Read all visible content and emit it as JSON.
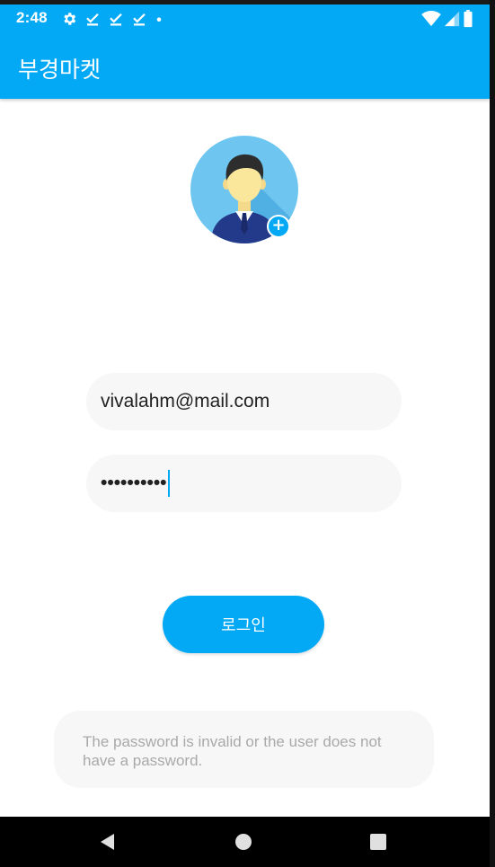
{
  "status_bar": {
    "time": "2:48",
    "left_icons": [
      "settings-gear-icon",
      "download-done-icon",
      "download-done-icon",
      "download-done-icon",
      "notification-dot-icon"
    ],
    "right_icons": [
      "wifi-icon",
      "cellular-signal-icon",
      "battery-icon"
    ]
  },
  "app_bar": {
    "title": "부경마켓"
  },
  "profile": {
    "avatar_icon": "user-avatar-icon",
    "add_badge": "+"
  },
  "login_form": {
    "email_value": "vivalahm@mail.com",
    "password_value": "••••••••••",
    "login_label": "로그인"
  },
  "error": {
    "message": "The password is invalid or the user does not have a password."
  },
  "nav_bar": {
    "back_icon": "back-triangle-icon",
    "home_icon": "home-circle-icon",
    "recents_icon": "recents-square-icon"
  },
  "colors": {
    "primary": "#03a9f4",
    "field_bg": "#f7f7f7",
    "error_text": "#a9a9a9"
  }
}
